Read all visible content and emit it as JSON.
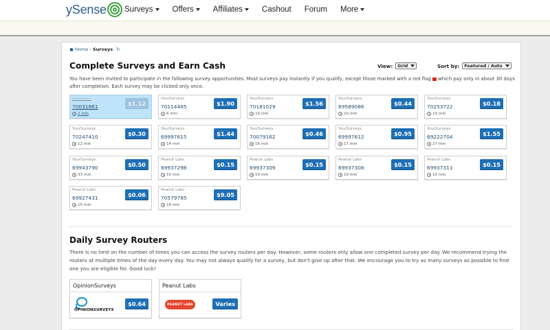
{
  "brand": {
    "name": "ySense"
  },
  "nav": {
    "items": [
      {
        "label": "Surveys",
        "dropdown": true
      },
      {
        "label": "Offers",
        "dropdown": true
      },
      {
        "label": "Affiliates",
        "dropdown": true
      },
      {
        "label": "Cashout",
        "dropdown": false
      },
      {
        "label": "Forum",
        "dropdown": false
      },
      {
        "label": "More",
        "dropdown": true
      }
    ]
  },
  "breadcrumb": {
    "home": "Home",
    "separator": "›",
    "current": "Surveys",
    "refresh_icon": "↻"
  },
  "page": {
    "title": "Complete Surveys and Earn Cash",
    "view_label": "View:",
    "view_value": "Grid",
    "sort_label": "Sort by:",
    "sort_value": "Featured / Auto",
    "intro_part1": "You have been invited to participate in the following survey opportunities. Most surveys pay instantly if you qualify, except those marked with a red flag",
    "intro_part2": "which pay only in about 30 days after completion. Each survey may be clicked only once."
  },
  "surveys": [
    {
      "provider": "—————",
      "id": "70031861",
      "time": "2 min",
      "price": "$1.12",
      "highlighted": true
    },
    {
      "provider": "YourSurveys",
      "id": "70114465",
      "time": "6 min",
      "price": "$1.90"
    },
    {
      "provider": "YourSurveys",
      "id": "70181029",
      "time": "10 min",
      "price": "$1.56"
    },
    {
      "provider": "YourSurveys",
      "id": "69589086",
      "time": "10 min",
      "price": "$0.44"
    },
    {
      "provider": "YourSurveys",
      "id": "70253722",
      "time": "10 min",
      "price": "$0.18"
    },
    {
      "provider": "YourSurveys",
      "id": "70247410",
      "time": "12 min",
      "price": "$0.30"
    },
    {
      "provider": "YourSurveys",
      "id": "69997615",
      "time": "14 min",
      "price": "$1.44"
    },
    {
      "provider": "YourSurveys",
      "id": "70079162",
      "time": "16 min",
      "price": "$0.46"
    },
    {
      "provider": "YourSurveys",
      "id": "69997612",
      "time": "17 min",
      "price": "$0.95"
    },
    {
      "provider": "YourSurveys",
      "id": "69222704",
      "time": "27 min",
      "price": "$1.55"
    },
    {
      "provider": "YourSurveys",
      "id": "69943790",
      "time": "33 min",
      "price": "$0.50"
    },
    {
      "provider": "Peanut Labs",
      "id": "69937298",
      "time": "10 min",
      "price": "$0.15"
    },
    {
      "provider": "Peanut Labs",
      "id": "69937309",
      "time": "10 min",
      "price": "$0.15"
    },
    {
      "provider": "Peanut Labs",
      "id": "69937308",
      "time": "10 min",
      "price": "$0.15"
    },
    {
      "provider": "Peanut Labs",
      "id": "69937311",
      "time": "10 min",
      "price": "$0.15"
    },
    {
      "provider": "Peanut Labs",
      "id": "69927431",
      "time": "15 min",
      "price": "$0.06"
    },
    {
      "provider": "Peanut Labs",
      "id": "70579785",
      "time": "18 min",
      "price": "$9.05"
    }
  ],
  "routers": {
    "title": "Daily Survey Routers",
    "description": "There is no limit on the number of times you can access the survey routers per day. However, some routers only allow one completed survey per day. We recommend trying the routers at multiple times of the day every day. You may not always qualify for a survey, but don't give up after that. We encourage you to try as many surveys as possible to find one you are eligible for. Good luck!",
    "items": [
      {
        "name": "OpinionSurveys",
        "logo_text": "OPINIONSURVEYS",
        "price": "$0.64"
      },
      {
        "name": "Peanut Labs",
        "logo_text": "PEANUT LABS",
        "price": "Varies"
      }
    ]
  },
  "colors": {
    "brand_blue": "#1e6fb5",
    "link": "#2d5f8b",
    "highlight": "#bfe3f8",
    "flag_red": "#dd2222"
  }
}
